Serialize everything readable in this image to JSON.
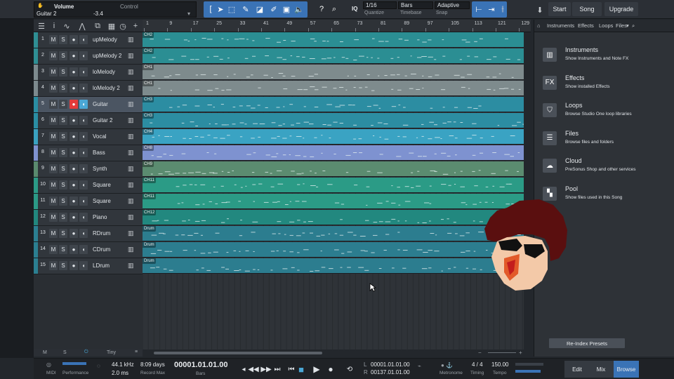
{
  "toolbar": {
    "volume_label": "Volume",
    "control_label": "Control",
    "track_label": "Guitar 2",
    "volume_value": "-3.4",
    "iq_label": "IQ",
    "quantize_value": "1/16",
    "quantize_label": "Quantize",
    "timebase_value": "Bars",
    "timebase_label": "Timebase",
    "snap_value": "Adaptive",
    "snap_label": "Snap",
    "start_label": "Start",
    "song_label": "Song",
    "upgrade_label": "Upgrade"
  },
  "ruler": {
    "ticks": [
      "1",
      "9",
      "17",
      "25",
      "33",
      "41",
      "49",
      "57",
      "65",
      "73",
      "81",
      "89",
      "97",
      "105",
      "113",
      "121",
      "129"
    ]
  },
  "tracks": [
    {
      "num": "1",
      "name": "upMelody",
      "color": "#2f8f94",
      "clip": "CH2",
      "lane": "#2b8e93",
      "selected": false
    },
    {
      "num": "2",
      "name": "upMelody 2",
      "color": "#2f8f94",
      "clip": "CH2",
      "lane": "#2b8e93",
      "selected": false
    },
    {
      "num": "3",
      "name": "loMelody",
      "color": "#7d8a8e",
      "clip": "CH1",
      "lane": "#7e8b8d",
      "selected": false
    },
    {
      "num": "4",
      "name": "loMelody 2",
      "color": "#7d8a8e",
      "clip": "CH1",
      "lane": "#7e8b8d",
      "selected": false
    },
    {
      "num": "5",
      "name": "Guitar",
      "color": "#2a8ea3",
      "clip": "CH3",
      "lane": "#2c8da2",
      "selected": true
    },
    {
      "num": "6",
      "name": "Guitar 2",
      "color": "#2a8ea3",
      "clip": "CH3",
      "lane": "#2c8da2",
      "selected": false
    },
    {
      "num": "7",
      "name": "Vocal",
      "color": "#3aa1c0",
      "clip": "CH4",
      "lane": "#3aa3c3",
      "selected": false
    },
    {
      "num": "8",
      "name": "Bass",
      "color": "#7f92cf",
      "clip": "CH8",
      "lane": "#7e92d0",
      "selected": false
    },
    {
      "num": "9",
      "name": "Synth",
      "color": "#5a8a6e",
      "clip": "CH9",
      "lane": "#5b8c70",
      "selected": false
    },
    {
      "num": "10",
      "name": "Square",
      "color": "#2b9a86",
      "clip": "CH11",
      "lane": "#2b9b86",
      "selected": false
    },
    {
      "num": "11",
      "name": "Square",
      "color": "#2b9a86",
      "clip": "CH11",
      "lane": "#2b9b86",
      "selected": false
    },
    {
      "num": "12",
      "name": "Piano",
      "color": "#22877e",
      "clip": "CH12",
      "lane": "#22887f",
      "selected": false
    },
    {
      "num": "13",
      "name": "RDrum",
      "color": "#2b7f91",
      "clip": "Drum",
      "lane": "#2c7d8f",
      "selected": false
    },
    {
      "num": "14",
      "name": "CDrum",
      "color": "#2b7f91",
      "clip": "Drum",
      "lane": "#2c7d8f",
      "selected": false
    },
    {
      "num": "15",
      "name": "LDrum",
      "color": "#2b7f91",
      "clip": "Drum",
      "lane": "#2c7d8f",
      "selected": false
    }
  ],
  "track_buttons": {
    "mute": "M",
    "solo": "S"
  },
  "track_footer": {
    "m": "M",
    "s": "S",
    "size": "Tiny"
  },
  "browser": {
    "tabs": [
      "Instruments",
      "Effects",
      "Loops",
      "Files"
    ],
    "items": [
      {
        "title": "Instruments",
        "sub": "Show Instruments and Note FX",
        "icon": "piano-icon"
      },
      {
        "title": "Effects",
        "sub": "Show installed Effects",
        "icon": "fx-icon"
      },
      {
        "title": "Loops",
        "sub": "Browse Studio One loop libraries",
        "icon": "loops-icon"
      },
      {
        "title": "Files",
        "sub": "Browse files and folders",
        "icon": "files-icon"
      },
      {
        "title": "Cloud",
        "sub": "PreSonus Shop and other services",
        "icon": "cloud-icon"
      },
      {
        "title": "Pool",
        "sub": "Show files used in this Song",
        "icon": "pool-icon"
      }
    ],
    "reindex_label": "Re-Index Presets"
  },
  "transport": {
    "midi_label": "MIDI",
    "performance_label": "Performance",
    "sample_rate": "44.1 kHz",
    "latency": "2.0 ms",
    "record_days": "8:09 days",
    "record_max_label": "Record Max",
    "position": "00001.01.01.00",
    "position_unit": "Bars",
    "loop_l_label": "L",
    "loop_l": "00001.01.01.00",
    "loop_r_label": "R",
    "loop_r": "00137.01.01.00",
    "metronome_label": "Metronome",
    "timesig": "4 / 4",
    "timing_label": "Timing",
    "tempo": "150.00",
    "tempo_label": "Tempo",
    "edit_label": "Edit",
    "mix_label": "Mix",
    "browse_label": "Browse"
  }
}
